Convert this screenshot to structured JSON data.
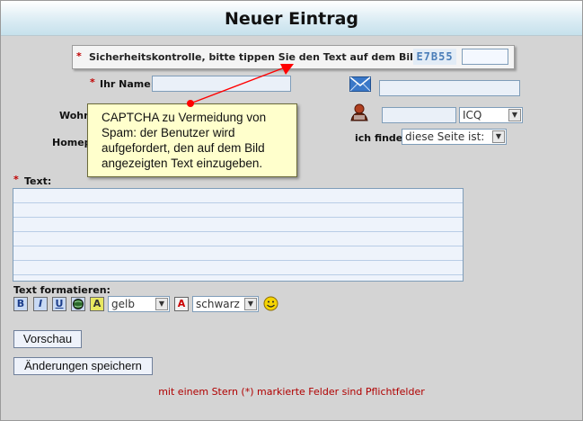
{
  "window": {
    "title": "Neuer Eintrag"
  },
  "captcha": {
    "label": "Sicherheitskontrolle, bitte tippen Sie den Text auf dem Bild ab:",
    "image_text": "E7B55",
    "value": ""
  },
  "form": {
    "name_label": "Ihr Name:",
    "name_value": "",
    "email_value": "",
    "wohnort_label_partial": "Wohn",
    "icq_value": "",
    "messenger_select": "ICQ",
    "homepage_label_partial": "Homep",
    "ich_finde_label": "ich finde",
    "rating_select": "diese Seite ist:",
    "text_label": "Text:",
    "text_value": ""
  },
  "formatting": {
    "label": "Text formatieren:",
    "bold": "B",
    "italic": "I",
    "underline": "U",
    "highlight": "A",
    "font_color_letter": "A",
    "highlight_color": "gelb",
    "text_color": "schwarz"
  },
  "buttons": {
    "preview": "Vorschau",
    "save": "Änderungen speichern"
  },
  "footer": "mit einem Stern (*) markierte Felder sind Pflichtfelder",
  "tooltip": {
    "text": "CAPTCHA zu Vermeidung von Spam: der Benutzer wird aufgefordert, den auf dem Bild angezeigten Text einzugeben."
  },
  "colors": {
    "required_star": "#c00000",
    "footer_text": "#b00000",
    "tooltip_bg": "#ffffcc",
    "annotation_arrow": "#ff0000"
  }
}
